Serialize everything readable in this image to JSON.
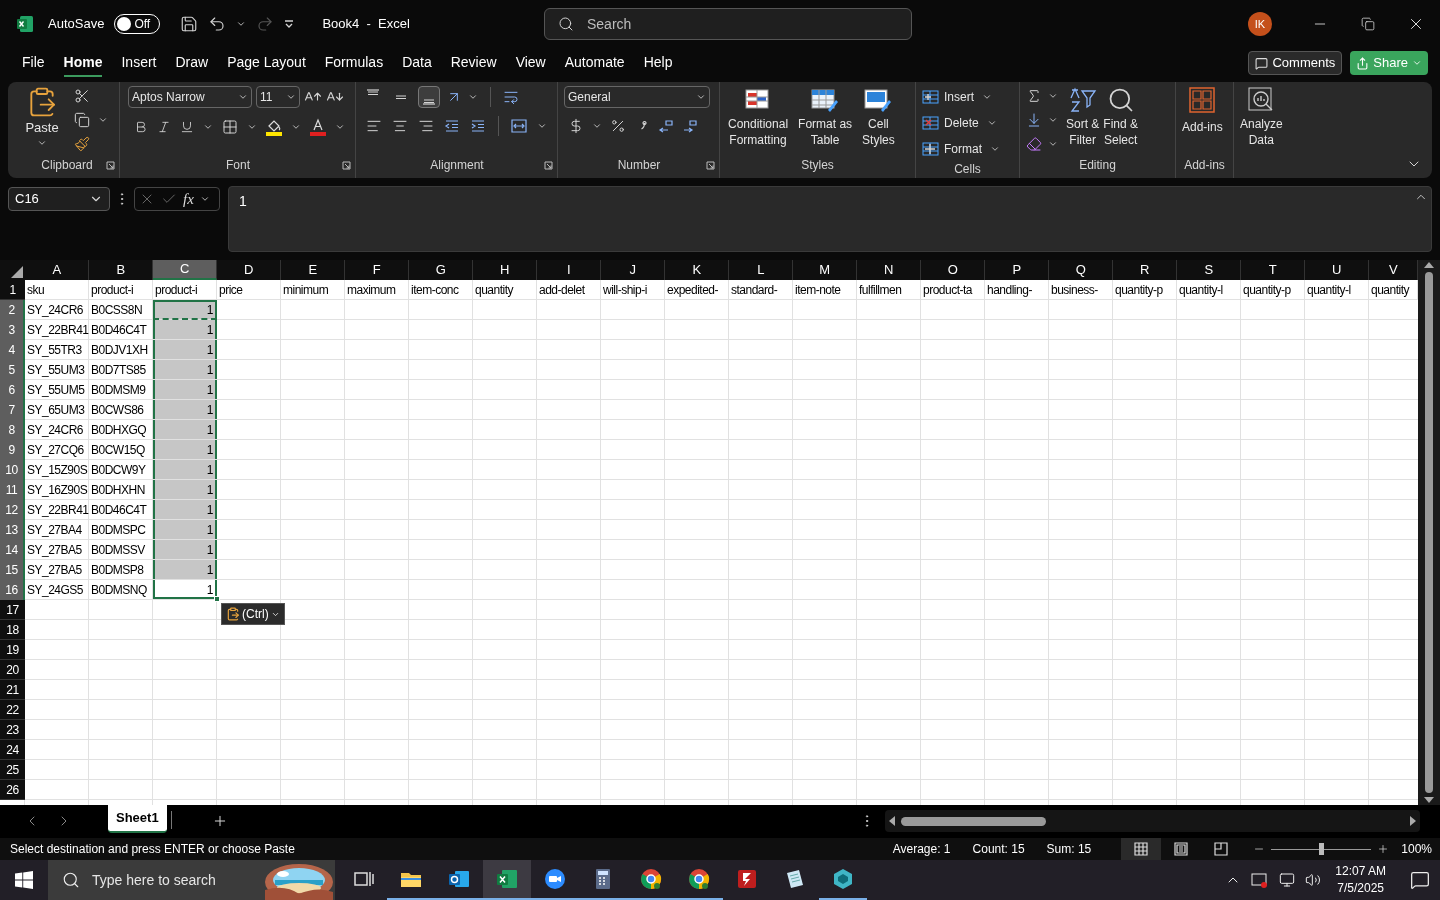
{
  "title_bar": {
    "autosave": {
      "label": "AutoSave",
      "state_label": "Off",
      "on": false
    },
    "redo": {
      "disabled": true
    },
    "title": "Book4  -  Excel",
    "search_placeholder": "Search",
    "avatar_initials": "IK"
  },
  "menu_tabs": [
    {
      "label": "File",
      "selected": false
    },
    {
      "label": "Home",
      "selected": true
    },
    {
      "label": "Insert",
      "selected": false
    },
    {
      "label": "Draw",
      "selected": false
    },
    {
      "label": "Page Layout",
      "selected": false
    },
    {
      "label": "Formulas",
      "selected": false
    },
    {
      "label": "Data",
      "selected": false
    },
    {
      "label": "Review",
      "selected": false
    },
    {
      "label": "View",
      "selected": false
    },
    {
      "label": "Automate",
      "selected": false
    },
    {
      "label": "Help",
      "selected": false
    }
  ],
  "comments_label": "Comments",
  "share_label": "Share",
  "ribbon": {
    "clipboard": {
      "label": "Clipboard",
      "paste": "Paste"
    },
    "font": {
      "label": "Font",
      "name": "Aptos Narrow",
      "size": "11"
    },
    "alignment": {
      "label": "Alignment",
      "vertical": [
        {
          "kind": "top",
          "selected": false
        },
        {
          "kind": "middle",
          "selected": false
        },
        {
          "kind": "bottom",
          "selected": true
        }
      ]
    },
    "number": {
      "label": "Number",
      "format": "General"
    },
    "styles": {
      "label": "Styles",
      "buttons": [
        {
          "kind": "conditional",
          "lines": [
            "Conditional",
            "Formatting"
          ]
        },
        {
          "kind": "table",
          "lines": [
            "Format as",
            "Table"
          ]
        },
        {
          "kind": "cell_styles",
          "lines": [
            "Cell",
            "Styles"
          ]
        }
      ]
    },
    "cells": {
      "label": "Cells",
      "buttons": [
        {
          "kind": "insert",
          "label": "Insert"
        },
        {
          "kind": "delete",
          "label": "Delete"
        },
        {
          "kind": "format",
          "label": "Format"
        }
      ]
    },
    "editing": {
      "label": "Editing",
      "buttons": [
        {
          "kind": "sort",
          "lines": [
            "Sort &",
            "Filter"
          ]
        },
        {
          "kind": "find",
          "lines": [
            "Find &",
            "Select"
          ]
        }
      ]
    },
    "addins": {
      "label": "Add-ins",
      "button": "Add-ins"
    },
    "analyze": {
      "lines": [
        "Analyze",
        "Data"
      ]
    }
  },
  "formula_bar": {
    "name_box": "C16",
    "function_label": "fx",
    "formula": "1"
  },
  "sheet": {
    "columns": [
      {
        "label": "A",
        "selected": false
      },
      {
        "label": "B",
        "selected": false
      },
      {
        "label": "C",
        "selected": true
      },
      {
        "label": "D",
        "selected": false
      },
      {
        "label": "E",
        "selected": false
      },
      {
        "label": "F",
        "selected": false
      },
      {
        "label": "G",
        "selected": false
      },
      {
        "label": "H",
        "selected": false
      },
      {
        "label": "I",
        "selected": false
      },
      {
        "label": "J",
        "selected": false
      },
      {
        "label": "K",
        "selected": false
      },
      {
        "label": "L",
        "selected": false
      },
      {
        "label": "M",
        "selected": false
      },
      {
        "label": "N",
        "selected": false
      },
      {
        "label": "O",
        "selected": false
      },
      {
        "label": "P",
        "selected": false
      },
      {
        "label": "Q",
        "selected": false
      },
      {
        "label": "R",
        "selected": false
      },
      {
        "label": "S",
        "selected": false
      },
      {
        "label": "T",
        "selected": false
      },
      {
        "label": "U",
        "selected": false
      },
      {
        "label": "V",
        "selected": false
      }
    ],
    "header_row": {
      "number": "1",
      "selected": false,
      "cells": [
        "sku",
        "product-i",
        "product-i",
        "price",
        "minimum",
        "maximum",
        "item-conc",
        "quantity",
        "add-delet",
        "will-ship-i",
        "expedited-",
        "standard-",
        "item-note",
        "fulfillmen",
        "product-ta",
        "handling-",
        "business-",
        "quantity-p",
        "quantity-l",
        "quantity-p",
        "quantity-l",
        "quantity"
      ]
    },
    "data_rows": [
      {
        "number": "2",
        "selected": true,
        "sku": "SY_24CR6",
        "col_b": "B0CSS8N",
        "col_c": {
          "text": "1",
          "selected": true,
          "active": false,
          "copied": true
        }
      },
      {
        "number": "3",
        "selected": true,
        "sku": "SY_22BR41",
        "col_b": "B0D46C4T",
        "col_c": {
          "text": "1",
          "selected": true,
          "active": false,
          "copied": false
        }
      },
      {
        "number": "4",
        "selected": true,
        "sku": "SY_55TR3",
        "col_b": "B0DJV1XH",
        "col_c": {
          "text": "1",
          "selected": true,
          "active": false,
          "copied": false
        }
      },
      {
        "number": "5",
        "selected": true,
        "sku": "SY_55UM3",
        "col_b": "B0D7TS85",
        "col_c": {
          "text": "1",
          "selected": true,
          "active": false,
          "copied": false
        }
      },
      {
        "number": "6",
        "selected": true,
        "sku": "SY_55UM5",
        "col_b": "B0DMSM9",
        "col_c": {
          "text": "1",
          "selected": true,
          "active": false,
          "copied": false
        }
      },
      {
        "number": "7",
        "selected": true,
        "sku": "SY_65UM3",
        "col_b": "B0CWS86",
        "col_c": {
          "text": "1",
          "selected": true,
          "active": false,
          "copied": false
        }
      },
      {
        "number": "8",
        "selected": true,
        "sku": "SY_24CR6",
        "col_b": "B0DHXGQ",
        "col_c": {
          "text": "1",
          "selected": true,
          "active": false,
          "copied": false
        }
      },
      {
        "number": "9",
        "selected": true,
        "sku": "SY_27CQ6",
        "col_b": "B0CW15Q",
        "col_c": {
          "text": "1",
          "selected": true,
          "active": false,
          "copied": false
        }
      },
      {
        "number": "10",
        "selected": true,
        "sku": "SY_15Z90S",
        "col_b": "B0DCW9Y",
        "col_c": {
          "text": "1",
          "selected": true,
          "active": false,
          "copied": false
        }
      },
      {
        "number": "11",
        "selected": true,
        "sku": "SY_16Z90S",
        "col_b": "B0DHXHN",
        "col_c": {
          "text": "1",
          "selected": true,
          "active": false,
          "copied": false
        }
      },
      {
        "number": "12",
        "selected": true,
        "sku": "SY_22BR41",
        "col_b": "B0D46C4T",
        "col_c": {
          "text": "1",
          "selected": true,
          "active": false,
          "copied": false
        }
      },
      {
        "number": "13",
        "selected": true,
        "sku": "SY_27BA4",
        "col_b": "B0DMSPC",
        "col_c": {
          "text": "1",
          "selected": true,
          "active": false,
          "copied": false
        }
      },
      {
        "number": "14",
        "selected": true,
        "sku": "SY_27BA5",
        "col_b": "B0DMSSV",
        "col_c": {
          "text": "1",
          "selected": true,
          "active": false,
          "copied": false
        }
      },
      {
        "number": "15",
        "selected": true,
        "sku": "SY_27BA5",
        "col_b": "B0DMSP8",
        "col_c": {
          "text": "1",
          "selected": true,
          "active": false,
          "copied": false
        }
      },
      {
        "number": "16",
        "selected": true,
        "sku": "SY_24GS5",
        "col_b": "B0DMSNQ",
        "col_c": {
          "text": "1",
          "selected": true,
          "active": true,
          "copied": false
        }
      }
    ],
    "empty_rows": [
      {
        "number": "17",
        "selected": false
      },
      {
        "number": "18",
        "selected": false
      },
      {
        "number": "19",
        "selected": false
      },
      {
        "number": "20",
        "selected": false
      },
      {
        "number": "21",
        "selected": false
      },
      {
        "number": "22",
        "selected": false
      },
      {
        "number": "23",
        "selected": false
      },
      {
        "number": "24",
        "selected": false
      },
      {
        "number": "25",
        "selected": false
      },
      {
        "number": "26",
        "selected": false
      }
    ],
    "paste_options": "(Ctrl)"
  },
  "sheet_tabs": [
    {
      "label": "Sheet1",
      "selected": true
    }
  ],
  "status_bar": {
    "message": "Select destination and press ENTER or choose Paste",
    "stats": [
      "Average: 1",
      "Count: 15",
      "Sum: 15"
    ],
    "views": [
      {
        "kind": "normal",
        "selected": true
      },
      {
        "kind": "page_layout",
        "selected": false
      },
      {
        "kind": "page_break",
        "selected": false
      }
    ],
    "zoom": {
      "level": 0.5,
      "label": "100%"
    }
  },
  "taskbar": {
    "search_placeholder": "Type here to search",
    "apps": [
      {
        "kind": "task_view",
        "running": false,
        "selected": false
      },
      {
        "kind": "explorer",
        "running": true,
        "selected": false
      },
      {
        "kind": "outlook",
        "running": true,
        "selected": false
      },
      {
        "kind": "excel",
        "running": true,
        "selected": true
      },
      {
        "kind": "zoom",
        "running": true,
        "selected": false
      },
      {
        "kind": "calculator",
        "running": true,
        "selected": false
      },
      {
        "kind": "chrome",
        "running": true,
        "selected": false
      },
      {
        "kind": "chrome",
        "running": true,
        "selected": false
      },
      {
        "kind": "filezilla",
        "running": false,
        "selected": false
      },
      {
        "kind": "notepad",
        "running": false,
        "selected": false
      },
      {
        "kind": "app",
        "running": true,
        "selected": false
      }
    ],
    "time": "12:07 AM",
    "date": "7/5/2025"
  }
}
